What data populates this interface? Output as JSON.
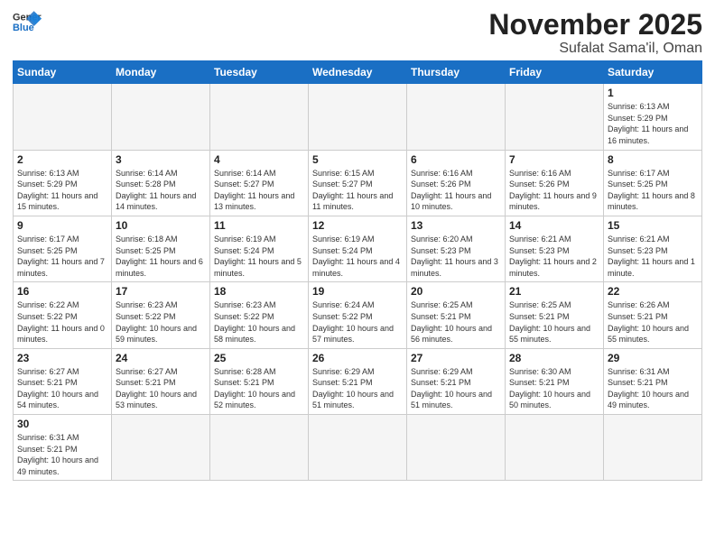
{
  "header": {
    "logo_general": "General",
    "logo_blue": "Blue",
    "title": "November 2025",
    "subtitle": "Sufalat Sama'il, Oman"
  },
  "weekdays": [
    "Sunday",
    "Monday",
    "Tuesday",
    "Wednesday",
    "Thursday",
    "Friday",
    "Saturday"
  ],
  "weeks": [
    [
      {
        "day": "",
        "info": ""
      },
      {
        "day": "",
        "info": ""
      },
      {
        "day": "",
        "info": ""
      },
      {
        "day": "",
        "info": ""
      },
      {
        "day": "",
        "info": ""
      },
      {
        "day": "",
        "info": ""
      },
      {
        "day": "1",
        "info": "Sunrise: 6:13 AM\nSunset: 5:29 PM\nDaylight: 11 hours\nand 16 minutes."
      }
    ],
    [
      {
        "day": "2",
        "info": "Sunrise: 6:13 AM\nSunset: 5:29 PM\nDaylight: 11 hours\nand 15 minutes."
      },
      {
        "day": "3",
        "info": "Sunrise: 6:14 AM\nSunset: 5:28 PM\nDaylight: 11 hours\nand 14 minutes."
      },
      {
        "day": "4",
        "info": "Sunrise: 6:14 AM\nSunset: 5:27 PM\nDaylight: 11 hours\nand 13 minutes."
      },
      {
        "day": "5",
        "info": "Sunrise: 6:15 AM\nSunset: 5:27 PM\nDaylight: 11 hours\nand 11 minutes."
      },
      {
        "day": "6",
        "info": "Sunrise: 6:16 AM\nSunset: 5:26 PM\nDaylight: 11 hours\nand 10 minutes."
      },
      {
        "day": "7",
        "info": "Sunrise: 6:16 AM\nSunset: 5:26 PM\nDaylight: 11 hours\nand 9 minutes."
      },
      {
        "day": "8",
        "info": "Sunrise: 6:17 AM\nSunset: 5:25 PM\nDaylight: 11 hours\nand 8 minutes."
      }
    ],
    [
      {
        "day": "9",
        "info": "Sunrise: 6:17 AM\nSunset: 5:25 PM\nDaylight: 11 hours\nand 7 minutes."
      },
      {
        "day": "10",
        "info": "Sunrise: 6:18 AM\nSunset: 5:25 PM\nDaylight: 11 hours\nand 6 minutes."
      },
      {
        "day": "11",
        "info": "Sunrise: 6:19 AM\nSunset: 5:24 PM\nDaylight: 11 hours\nand 5 minutes."
      },
      {
        "day": "12",
        "info": "Sunrise: 6:19 AM\nSunset: 5:24 PM\nDaylight: 11 hours\nand 4 minutes."
      },
      {
        "day": "13",
        "info": "Sunrise: 6:20 AM\nSunset: 5:23 PM\nDaylight: 11 hours\nand 3 minutes."
      },
      {
        "day": "14",
        "info": "Sunrise: 6:21 AM\nSunset: 5:23 PM\nDaylight: 11 hours\nand 2 minutes."
      },
      {
        "day": "15",
        "info": "Sunrise: 6:21 AM\nSunset: 5:23 PM\nDaylight: 11 hours\nand 1 minute."
      }
    ],
    [
      {
        "day": "16",
        "info": "Sunrise: 6:22 AM\nSunset: 5:22 PM\nDaylight: 11 hours\nand 0 minutes."
      },
      {
        "day": "17",
        "info": "Sunrise: 6:23 AM\nSunset: 5:22 PM\nDaylight: 10 hours\nand 59 minutes."
      },
      {
        "day": "18",
        "info": "Sunrise: 6:23 AM\nSunset: 5:22 PM\nDaylight: 10 hours\nand 58 minutes."
      },
      {
        "day": "19",
        "info": "Sunrise: 6:24 AM\nSunset: 5:22 PM\nDaylight: 10 hours\nand 57 minutes."
      },
      {
        "day": "20",
        "info": "Sunrise: 6:25 AM\nSunset: 5:21 PM\nDaylight: 10 hours\nand 56 minutes."
      },
      {
        "day": "21",
        "info": "Sunrise: 6:25 AM\nSunset: 5:21 PM\nDaylight: 10 hours\nand 55 minutes."
      },
      {
        "day": "22",
        "info": "Sunrise: 6:26 AM\nSunset: 5:21 PM\nDaylight: 10 hours\nand 55 minutes."
      }
    ],
    [
      {
        "day": "23",
        "info": "Sunrise: 6:27 AM\nSunset: 5:21 PM\nDaylight: 10 hours\nand 54 minutes."
      },
      {
        "day": "24",
        "info": "Sunrise: 6:27 AM\nSunset: 5:21 PM\nDaylight: 10 hours\nand 53 minutes."
      },
      {
        "day": "25",
        "info": "Sunrise: 6:28 AM\nSunset: 5:21 PM\nDaylight: 10 hours\nand 52 minutes."
      },
      {
        "day": "26",
        "info": "Sunrise: 6:29 AM\nSunset: 5:21 PM\nDaylight: 10 hours\nand 51 minutes."
      },
      {
        "day": "27",
        "info": "Sunrise: 6:29 AM\nSunset: 5:21 PM\nDaylight: 10 hours\nand 51 minutes."
      },
      {
        "day": "28",
        "info": "Sunrise: 6:30 AM\nSunset: 5:21 PM\nDaylight: 10 hours\nand 50 minutes."
      },
      {
        "day": "29",
        "info": "Sunrise: 6:31 AM\nSunset: 5:21 PM\nDaylight: 10 hours\nand 49 minutes."
      }
    ],
    [
      {
        "day": "30",
        "info": "Sunrise: 6:31 AM\nSunset: 5:21 PM\nDaylight: 10 hours\nand 49 minutes."
      },
      {
        "day": "",
        "info": ""
      },
      {
        "day": "",
        "info": ""
      },
      {
        "day": "",
        "info": ""
      },
      {
        "day": "",
        "info": ""
      },
      {
        "day": "",
        "info": ""
      },
      {
        "day": "",
        "info": ""
      }
    ]
  ]
}
